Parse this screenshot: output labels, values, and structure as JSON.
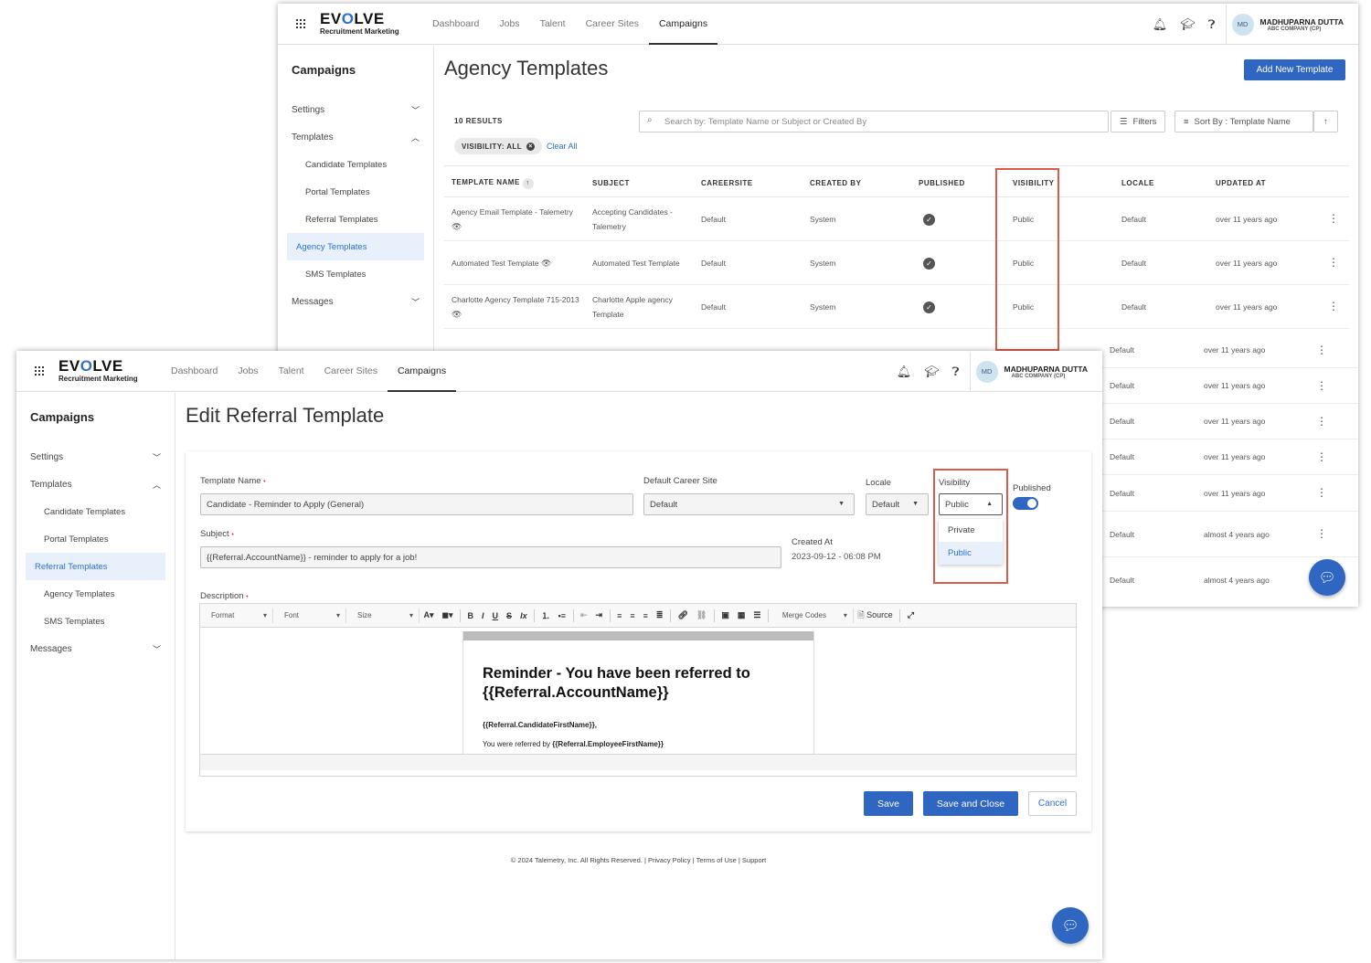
{
  "nav": {
    "logo_main_pre": "EV",
    "logo_main_o": "O",
    "logo_main_post": "LVE",
    "logo_sub": "Recruitment Marketing",
    "links": [
      "Dashboard",
      "Jobs",
      "Talent",
      "Career Sites",
      "Campaigns"
    ],
    "user_initials": "MD",
    "user_name": "MADHUPARNA DUTTA",
    "user_company": "ABC COMPANY (CP)"
  },
  "sidebar": {
    "title": "Campaigns",
    "settings": "Settings",
    "templates": "Templates",
    "items": [
      "Candidate Templates",
      "Portal Templates",
      "Referral Templates",
      "Agency Templates",
      "SMS Templates"
    ],
    "messages": "Messages"
  },
  "agency": {
    "title": "Agency Templates",
    "add_button": "Add New Template",
    "results": "10 RESULTS",
    "search_placeholder": "Search by: Template Name or Subject or Created By",
    "filters": "Filters",
    "sort": "Sort By : Template Name",
    "chip": "VISIBILITY: ALL",
    "clear_all": "Clear All",
    "columns": [
      "TEMPLATE NAME",
      "SUBJECT",
      "CAREERSITE",
      "CREATED BY",
      "PUBLISHED",
      "VISIBILITY",
      "LOCALE",
      "UPDATED AT"
    ],
    "rows": [
      {
        "name": "Agency Email Template - Talemetry",
        "subject": "Accepting Candidates - Talemetry",
        "careersite": "Default",
        "created_by": "System",
        "visibility": "Public",
        "locale": "Default",
        "updated": "over 11 years ago"
      },
      {
        "name": "Automated Test Template",
        "subject": "Automated Test Template",
        "careersite": "Default",
        "created_by": "System",
        "visibility": "Public",
        "locale": "Default",
        "updated": "over 11 years ago"
      },
      {
        "name": "Charlotte Agency Template 715-2013",
        "subject": "Charlotte Apple agency Template",
        "careersite": "Default",
        "created_by": "System",
        "visibility": "Public",
        "locale": "Default",
        "updated": "over 11 years ago"
      }
    ],
    "hidden_rows": [
      {
        "locale": "Default",
        "updated": "over 11 years ago"
      },
      {
        "locale": "Default",
        "updated": "over 11 years ago"
      },
      {
        "locale": "Default",
        "updated": "over 11 years ago"
      },
      {
        "locale": "Default",
        "updated": "over 11 years ago"
      },
      {
        "locale": "Default",
        "updated": "over 11 years ago"
      },
      {
        "locale": "Default",
        "updated": "almost 4 years ago"
      },
      {
        "locale": "Default",
        "updated": "almost 4 years ago"
      }
    ]
  },
  "edit": {
    "title": "Edit Referral Template",
    "template_name_label": "Template Name",
    "template_name_value": "Candidate - Reminder to Apply (General)",
    "career_site_label": "Default Career Site",
    "career_site_value": "Default",
    "locale_label": "Locale",
    "locale_value": "Default",
    "visibility_label": "Visibility",
    "visibility_value": "Public",
    "visibility_options": [
      "Private",
      "Public"
    ],
    "published_label": "Published",
    "published_on": true,
    "subject_label": "Subject",
    "subject_value": "{{Referral.AccountName}} - reminder to apply for a job!",
    "created_at_label": "Created At",
    "created_at_value": "2023-09-12 - 06:08 PM",
    "description_label": "Description",
    "toolbar": {
      "format": "Format",
      "font": "Font",
      "size": "Size",
      "merge_codes": "Merge Codes",
      "source": "Source"
    },
    "email_heading": "Reminder - You have been referred to {{Referral.AccountName}}",
    "email_line1": "{{Referral.CandidateFirstName}},",
    "email_line2_pre": "You were referred by ",
    "email_line2_code": "{{Referral.EmployeeFirstName}}",
    "save": "Save",
    "save_close": "Save and Close",
    "cancel": "Cancel",
    "footer": "© 2024 Talemetry, Inc. All Rights Reserved.   |   Privacy Policy   |   Terms of Use   |   Support"
  },
  "colors": {
    "primary": "#2e66c2",
    "highlight": "#d85c48",
    "active_bg": "#e8f1fb"
  }
}
